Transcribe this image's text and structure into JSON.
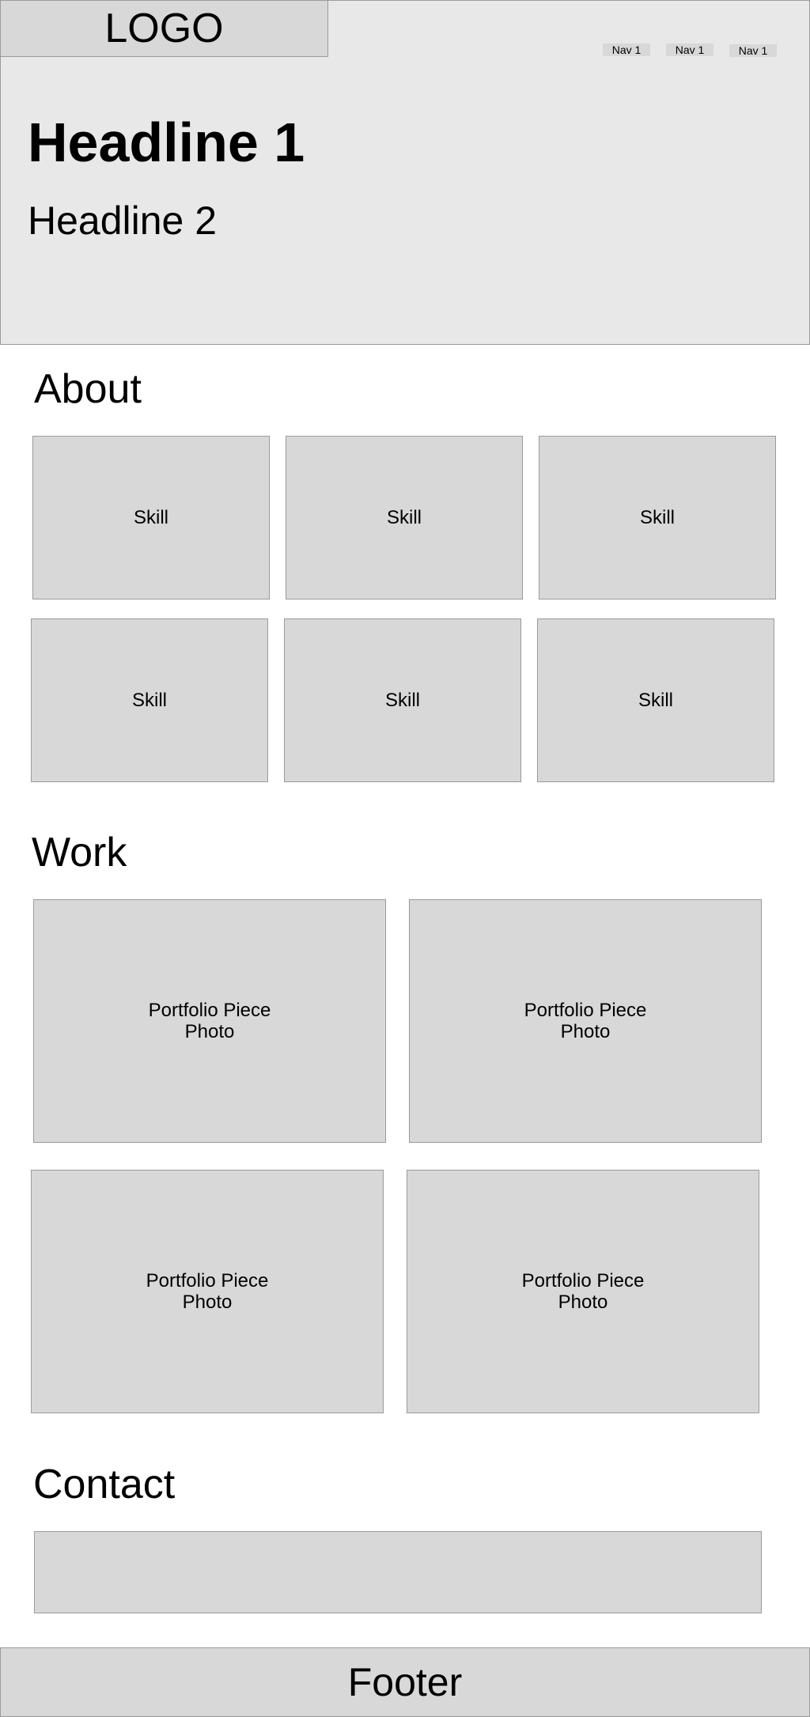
{
  "header": {
    "logo": "LOGO",
    "nav": [
      "Nav 1",
      "Nav 1",
      "Nav 1"
    ],
    "headline1": "Headline 1",
    "headline2": "Headline 2"
  },
  "about": {
    "title": "About",
    "skills": [
      "Skill",
      "Skill",
      "Skill",
      "Skill",
      "Skill",
      "Skill"
    ]
  },
  "work": {
    "title": "Work",
    "pieces": [
      {
        "line1": "Portfolio Piece",
        "line2": "Photo"
      },
      {
        "line1": "Portfolio Piece",
        "line2": "Photo"
      },
      {
        "line1": "Portfolio Piece",
        "line2": "Photo"
      },
      {
        "line1": "Portfolio Piece",
        "line2": "Photo"
      }
    ]
  },
  "contact": {
    "title": "Contact"
  },
  "footer": {
    "label": "Footer"
  }
}
